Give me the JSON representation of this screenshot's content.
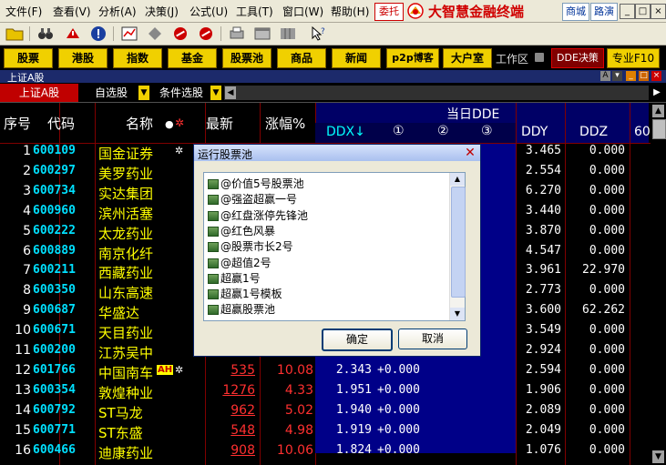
{
  "menu": {
    "items": [
      "文件(F)",
      "查看(V)",
      "分析(A)",
      "决策(J)",
      "公式(U)",
      "工具(T)",
      "窗口(W)",
      "帮助(H)"
    ],
    "entrust": "委托",
    "brand": "大智慧金融终端",
    "mall": "商城",
    "roadshow": "路演"
  },
  "func_buttons": [
    "股票",
    "港股",
    "指数",
    "基金",
    "股票池",
    "商品",
    "新闻",
    "p2p博客",
    "大户室"
  ],
  "workarea_label": "工作区",
  "dde_button": "DDE决策",
  "f10_button": "专业F10",
  "market_title": "上证A股",
  "title_badge": "A",
  "tabs": {
    "a": "上证A股",
    "b": "自选股",
    "c": "条件选股"
  },
  "headers": {
    "seq": "序号",
    "code": "代码",
    "name": "名称",
    "latest": "最新",
    "change": "涨幅%",
    "dde_group": "当日DDE",
    "ddx": "DDX↓",
    "c1": "①",
    "c2": "②",
    "c3": "③",
    "ddy": "DDY",
    "ddz": "DDZ",
    "col60": "60"
  },
  "rows": [
    {
      "seq": "1",
      "code": "600109",
      "name": "国金证券",
      "price": "",
      "chg": "",
      "ddx": "",
      "ddx2": "",
      "ddy": "3.465",
      "ddz": "0.000"
    },
    {
      "seq": "2",
      "code": "600297",
      "name": "美罗药业",
      "price": "",
      "chg": "",
      "ddx": "",
      "ddx2": "",
      "ddy": "2.554",
      "ddz": "0.000"
    },
    {
      "seq": "3",
      "code": "600734",
      "name": "实达集团",
      "price": "",
      "chg": "",
      "ddx": "",
      "ddx2": "",
      "ddy": "6.270",
      "ddz": "0.000"
    },
    {
      "seq": "4",
      "code": "600960",
      "name": "滨州活塞",
      "price": "",
      "chg": "",
      "ddx": "",
      "ddx2": "",
      "ddy": "3.440",
      "ddz": "0.000"
    },
    {
      "seq": "5",
      "code": "600222",
      "name": "太龙药业",
      "price": "",
      "chg": "",
      "ddx": "",
      "ddx2": "",
      "ddy": "3.870",
      "ddz": "0.000"
    },
    {
      "seq": "6",
      "code": "600889",
      "name": "南京化纤",
      "price": "",
      "chg": "",
      "ddx": "",
      "ddx2": "",
      "ddy": "4.547",
      "ddz": "0.000"
    },
    {
      "seq": "7",
      "code": "600211",
      "name": "西藏药业",
      "price": "",
      "chg": "",
      "ddx": "",
      "ddx2": "",
      "ddy": "3.961",
      "ddz": "22.970"
    },
    {
      "seq": "8",
      "code": "600350",
      "name": "山东高速",
      "price": "",
      "chg": "",
      "ddx": "",
      "ddx2": "",
      "ddy": "2.773",
      "ddz": "0.000"
    },
    {
      "seq": "9",
      "code": "600687",
      "name": "华盛达",
      "price": "",
      "chg": "",
      "ddx": "",
      "ddx2": "",
      "ddy": "3.600",
      "ddz": "62.262"
    },
    {
      "seq": "10",
      "code": "600671",
      "name": "天目药业",
      "price": "",
      "chg": "",
      "ddx": "",
      "ddx2": "",
      "ddy": "3.549",
      "ddz": "0.000"
    },
    {
      "seq": "11",
      "code": "600200",
      "name": "江苏吴中",
      "price": "",
      "chg": "",
      "ddx": "",
      "ddx2": "",
      "ddy": "2.924",
      "ddz": "0.000"
    },
    {
      "seq": "12",
      "code": "601766",
      "name": "中国南车",
      "price": "535",
      "chg": "10.08",
      "ddx": "2.343",
      "ddx2": "+0.000",
      "ddy": "2.594",
      "ddz": "0.000",
      "badge": "AH"
    },
    {
      "seq": "13",
      "code": "600354",
      "name": "敦煌种业",
      "price": "1276",
      "chg": "4.33",
      "ddx": "1.951",
      "ddx2": "+0.000",
      "ddy": "1.906",
      "ddz": "0.000"
    },
    {
      "seq": "14",
      "code": "600792",
      "name": "ST马龙",
      "price": "962",
      "chg": "5.02",
      "ddx": "1.940",
      "ddx2": "+0.000",
      "ddy": "2.089",
      "ddz": "0.000"
    },
    {
      "seq": "15",
      "code": "600771",
      "name": "ST东盛",
      "price": "548",
      "chg": "4.98",
      "ddx": "1.919",
      "ddx2": "+0.000",
      "ddy": "2.049",
      "ddz": "0.000"
    },
    {
      "seq": "16",
      "code": "600466",
      "name": "迪康药业",
      "price": "908",
      "chg": "10.06",
      "ddx": "1.824",
      "ddx2": "+0.000",
      "ddy": "1.076",
      "ddz": "0.000"
    }
  ],
  "dialog": {
    "title": "运行股票池",
    "items": [
      "@价值5号股票池",
      "@强盗超赢一号",
      "@红盘涨停先锋池",
      "@红色风暴",
      "@股票市长2号",
      "@超值2号",
      "超赢1号",
      "超赢1号模板",
      "超赢股票池"
    ],
    "ok": "确定",
    "cancel": "取消"
  }
}
